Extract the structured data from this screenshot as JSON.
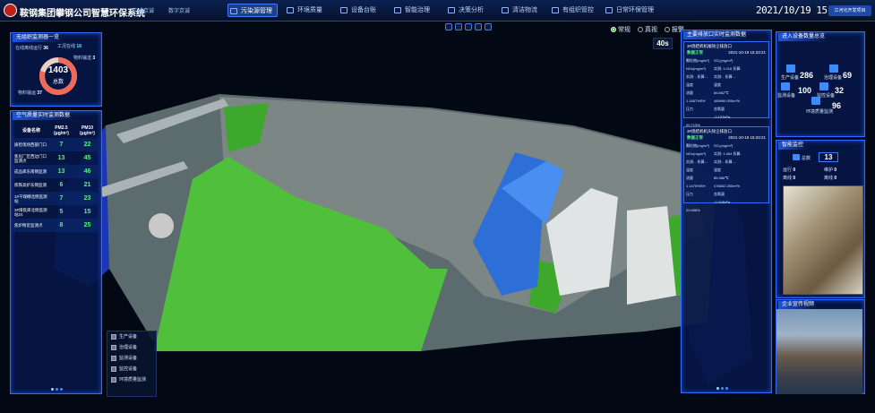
{
  "header": {
    "system_name": "鞍钢集团攀钢公司智慧环保系统",
    "partner1": "中冶京诚",
    "partner2": "数字京诚",
    "nav": [
      {
        "label": "污染源管理",
        "active": true
      },
      {
        "label": "环境质量",
        "active": false
      },
      {
        "label": "设备台账",
        "active": false
      },
      {
        "label": "智能治理",
        "active": false
      },
      {
        "label": "决策分析",
        "active": false
      },
      {
        "label": "清洁物流",
        "active": false
      },
      {
        "label": "有组织管控",
        "active": false
      },
      {
        "label": "日常环保管理",
        "active": false
      }
    ],
    "clock": "2021/10/19 15:35:43",
    "user_select": "江河化开发项目"
  },
  "view_mode": {
    "options": [
      "常规",
      "真视",
      "报警"
    ],
    "selected": "常规",
    "timer": "40s"
  },
  "left_top": {
    "title": "无组织监测器一览",
    "ring_value": "1403",
    "ring_label": "总数",
    "items": [
      {
        "label": "在线离线运行",
        "value": "36"
      },
      {
        "label": "工况在线",
        "value": "18"
      },
      {
        "label": "物料输送",
        "value": "3"
      },
      {
        "label": "物料输运",
        "value": "37"
      }
    ]
  },
  "air_quality": {
    "title": "空气质量实时监测数据",
    "headers": [
      "设备名称",
      "PM2.5 (μg/m³)",
      "PM10 (μg/m³)"
    ],
    "rows": [
      {
        "name": "质检现场西部门口",
        "pm25": "7",
        "pm10": "22"
      },
      {
        "name": "焦化厂区西边门口监测点",
        "pm25": "13",
        "pm10": "45"
      },
      {
        "name": "成品库东南侧监测",
        "pm25": "13",
        "pm10": "46"
      },
      {
        "name": "炼铁高炉东侧监测",
        "pm25": "6",
        "pm10": "21"
      },
      {
        "name": "1#干煤棚北侧监测站",
        "pm25": "7",
        "pm10": "23"
      },
      {
        "name": "3#煤焦库北侧监测站24",
        "pm25": "5",
        "pm10": "15"
      },
      {
        "name": "焦炉附近监测点",
        "pm25": "8",
        "pm10": "25"
      }
    ]
  },
  "legend": [
    "生产设备",
    "治理设备",
    "监测设备",
    "监控设备",
    "环境质量监测"
  ],
  "emissions": {
    "title": "主要排放口实时监测数据",
    "cards": [
      {
        "name": "3#烧结机机尾除尘排放口",
        "status": "数据正常",
        "time": "2021-10-19 15:33:21",
        "cols": [
          "颗粒物(mg/m³)",
          "SO₂(mg/m³)",
          "NOx(mg/m³)"
        ],
        "rows": [
          [
            "实测: 1.016 折算: -",
            "实测: - 折算: -",
            "实测: - 折算: -"
          ],
          [
            "温度",
            "湿度",
            "流量"
          ],
          [
            "86.662℃",
            "1.1667%RH",
            "465990.000m³/h"
          ],
          [
            "压力",
            "含氧量",
            ""
          ],
          [
            "-0.157kPa",
            "20.713%",
            ""
          ]
        ]
      },
      {
        "name": "3#烧结机机头除尘排放口",
        "status": "数据正常",
        "time": "2021-10-19 15:33:21",
        "cols": [
          "颗粒物(mg/m³)",
          "SO₂(mg/m³)",
          "NOx(mg/m³)"
        ],
        "rows": [
          [
            "实测: 1.464 折算: -",
            "实测: - 折算: -",
            "实测: - 折算: -"
          ],
          [
            "温度",
            "湿度",
            "流量"
          ],
          [
            "85.986℃",
            "1.1475%RH",
            "476602.250m³/h"
          ],
          [
            "压力",
            "含氧量",
            ""
          ],
          [
            "-0.318kPa",
            "20.698%",
            ""
          ]
        ]
      }
    ]
  },
  "devices": {
    "title": "进入设备数量总览",
    "items": [
      {
        "label": "生产设备",
        "value": "286"
      },
      {
        "label": "治理设备",
        "value": "69"
      },
      {
        "label": "监测设备",
        "value": "100"
      },
      {
        "label": "监控设备",
        "value": "32"
      },
      {
        "label": "环境质量监测",
        "value": "96"
      }
    ]
  },
  "monitoring": {
    "title": "智能监控",
    "total_label": "总数",
    "total": "13",
    "stats": [
      {
        "label": "运行",
        "value": "0"
      },
      {
        "label": "维护",
        "value": "0"
      },
      {
        "label": "离线",
        "value": "0"
      },
      {
        "label": "离线",
        "value": "0"
      }
    ]
  },
  "promo": {
    "title": "企业宣传视频"
  },
  "colors": {
    "accent": "#2f6cff",
    "good": "#55f08a",
    "ring": "#f06a5a"
  }
}
